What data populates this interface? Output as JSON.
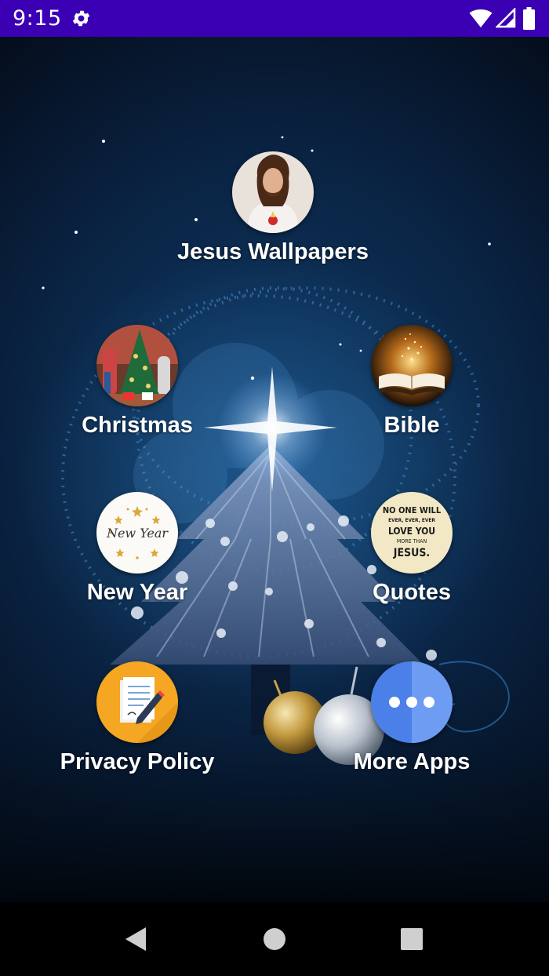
{
  "status_bar": {
    "time": "9:15",
    "background": "#3b00b3",
    "icons": [
      "gear-icon",
      "wifi-icon",
      "signal-icon",
      "battery-icon"
    ]
  },
  "menu": {
    "items": [
      {
        "id": "jesus-wallpapers",
        "label": "Jesus Wallpapers",
        "icon": "jesus-portrait-icon"
      },
      {
        "id": "christmas",
        "label": "Christmas",
        "icon": "christmas-tree-photo-icon"
      },
      {
        "id": "bible",
        "label": "Bible",
        "icon": "open-bible-icon"
      },
      {
        "id": "new-year",
        "label": "New Year",
        "icon": "new-year-card-icon",
        "icon_text": "New Year"
      },
      {
        "id": "quotes",
        "label": "Quotes",
        "icon": "quote-card-icon",
        "icon_text": [
          "NO ONE WILL",
          "EVER, EVER, EVER",
          "LOVE YOU",
          "MORE THAN",
          "JESUS."
        ]
      },
      {
        "id": "privacy-policy",
        "label": "Privacy Policy",
        "icon": "document-pen-icon"
      },
      {
        "id": "more-apps",
        "label": "More Apps",
        "icon": "more-dots-icon"
      }
    ]
  },
  "nav_bar": {
    "buttons": [
      "back-icon",
      "home-icon",
      "recents-icon"
    ]
  },
  "colors": {
    "accent_status": "#3b00b3",
    "privacy_circle": "#f5a623",
    "more_apps_circle": "#4a80e8"
  }
}
